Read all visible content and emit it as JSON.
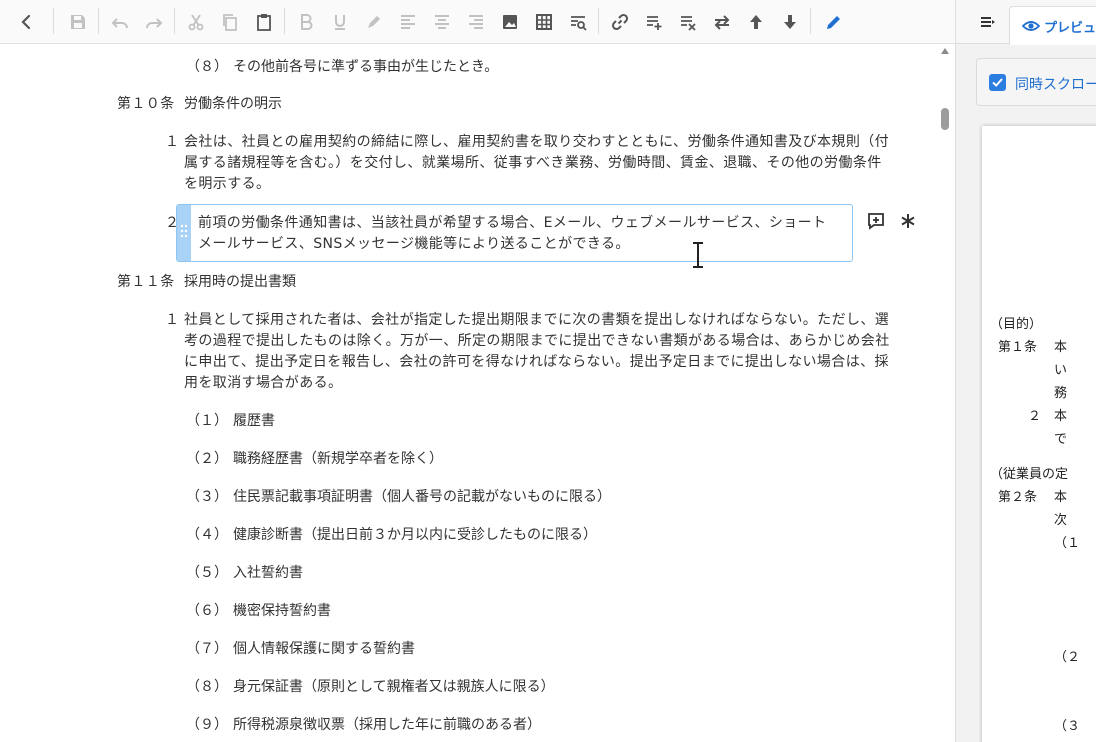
{
  "toolbar": {
    "icons": [
      "back-icon",
      "save-icon",
      "undo-icon",
      "redo-icon",
      "cut-icon",
      "copy-icon",
      "paste-icon",
      "bold-icon",
      "underline-icon",
      "highlight-icon",
      "align-left-icon",
      "align-center-icon",
      "align-right-icon",
      "image-icon",
      "table-icon",
      "search-icon",
      "link-icon",
      "add-row-icon",
      "remove-format-icon",
      "swap-icon",
      "move-up-icon",
      "move-down-icon",
      "edit-icon"
    ]
  },
  "right_panel": {
    "preview_tab": "プレビュ",
    "sync_scroll_label": "同時スクロー",
    "sync_scroll_checked": true,
    "preview_lines": [
      "（目的）",
      "第１条",
      "本",
      "い",
      "務",
      "２",
      "本",
      "で",
      "（従業員の定",
      "第２条",
      "本",
      "次",
      "（１",
      "（２",
      "（３"
    ]
  },
  "document": {
    "top_item": {
      "num": "（８）",
      "text": "その他前各号に準ずる事由が生じたとき。"
    },
    "article10": {
      "num": "第１０条",
      "title": "労働条件の明示",
      "para1": {
        "num": "１",
        "lines": [
          "会社は、社員との雇用契約の締結に際し、雇用契約書を取り交わすとともに、労働条件通知書及び本規則（付",
          "属する諸規程等を含む。）を交付し、就業場所、従事すべき業務、労働時間、賃金、退職、その他の労働条件",
          "を明示する。"
        ]
      },
      "para2": {
        "num": "２",
        "lines": [
          "前項の労働条件通知書は、当該社員が希望する場合、Eメール、ウェブメールサービス、ショート",
          "メールサービス、SNSメッセージ機能等により送ることができる。"
        ]
      }
    },
    "article11": {
      "num": "第１１条",
      "title": "採用時の提出書類",
      "para1": {
        "num": "１",
        "lines": [
          "社員として採用された者は、会社が指定した提出期限までに次の書類を提出しなければならない。ただし、選",
          "考の過程で提出したものは除く。万が一、所定の期限までに提出できない書類がある場合は、あらかじめ会社",
          "に申出て、提出予定日を報告し、会社の許可を得なければならない。提出予定日までに提出しない場合は、採",
          "用を取消す場合がある。"
        ]
      },
      "items": [
        {
          "num": "（１）",
          "text": "履歴書"
        },
        {
          "num": "（２）",
          "text": "職務経歴書（新規学卒者を除く）"
        },
        {
          "num": "（３）",
          "text": "住民票記載事項証明書（個人番号の記載がないものに限る）"
        },
        {
          "num": "（４）",
          "text": "健康診断書（提出日前３か月以内に受診したものに限る）"
        },
        {
          "num": "（５）",
          "text": "入社誓約書"
        },
        {
          "num": "（６）",
          "text": "機密保持誓約書"
        },
        {
          "num": "（７）",
          "text": "個人情報保護に関する誓約書"
        },
        {
          "num": "（８）",
          "text": "身元保証書（原則として親権者又は親族人に限る）"
        },
        {
          "num": "（９）",
          "text": "所得税源泉徴収票（採用した年に前職のある者）"
        }
      ]
    }
  },
  "colors": {
    "accent": "#1f6fd1",
    "selection_border": "#8ec5f2",
    "handle": "#a9d3f6",
    "icon": "#555555",
    "icon_disabled": "#bdbdbd"
  }
}
